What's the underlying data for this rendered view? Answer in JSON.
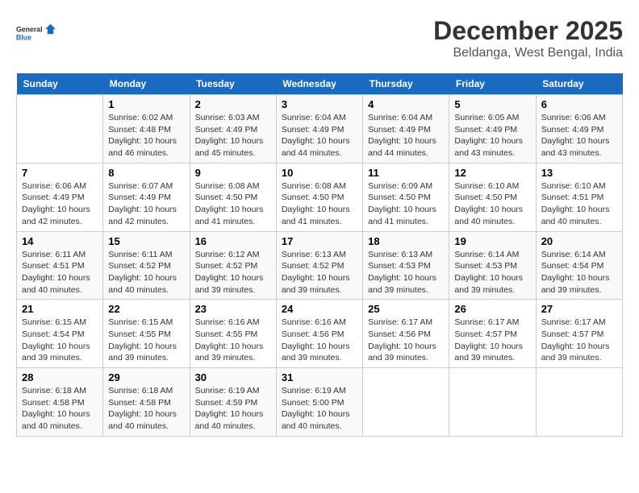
{
  "header": {
    "logo_line1": "General",
    "logo_line2": "Blue",
    "month_title": "December 2025",
    "location": "Beldanga, West Bengal, India"
  },
  "days_of_week": [
    "Sunday",
    "Monday",
    "Tuesday",
    "Wednesday",
    "Thursday",
    "Friday",
    "Saturday"
  ],
  "weeks": [
    [
      {
        "num": "",
        "sunrise": "",
        "sunset": "",
        "daylight": ""
      },
      {
        "num": "1",
        "sunrise": "Sunrise: 6:02 AM",
        "sunset": "Sunset: 4:48 PM",
        "daylight": "Daylight: 10 hours and 46 minutes."
      },
      {
        "num": "2",
        "sunrise": "Sunrise: 6:03 AM",
        "sunset": "Sunset: 4:49 PM",
        "daylight": "Daylight: 10 hours and 45 minutes."
      },
      {
        "num": "3",
        "sunrise": "Sunrise: 6:04 AM",
        "sunset": "Sunset: 4:49 PM",
        "daylight": "Daylight: 10 hours and 44 minutes."
      },
      {
        "num": "4",
        "sunrise": "Sunrise: 6:04 AM",
        "sunset": "Sunset: 4:49 PM",
        "daylight": "Daylight: 10 hours and 44 minutes."
      },
      {
        "num": "5",
        "sunrise": "Sunrise: 6:05 AM",
        "sunset": "Sunset: 4:49 PM",
        "daylight": "Daylight: 10 hours and 43 minutes."
      },
      {
        "num": "6",
        "sunrise": "Sunrise: 6:06 AM",
        "sunset": "Sunset: 4:49 PM",
        "daylight": "Daylight: 10 hours and 43 minutes."
      }
    ],
    [
      {
        "num": "7",
        "sunrise": "Sunrise: 6:06 AM",
        "sunset": "Sunset: 4:49 PM",
        "daylight": "Daylight: 10 hours and 42 minutes."
      },
      {
        "num": "8",
        "sunrise": "Sunrise: 6:07 AM",
        "sunset": "Sunset: 4:49 PM",
        "daylight": "Daylight: 10 hours and 42 minutes."
      },
      {
        "num": "9",
        "sunrise": "Sunrise: 6:08 AM",
        "sunset": "Sunset: 4:50 PM",
        "daylight": "Daylight: 10 hours and 41 minutes."
      },
      {
        "num": "10",
        "sunrise": "Sunrise: 6:08 AM",
        "sunset": "Sunset: 4:50 PM",
        "daylight": "Daylight: 10 hours and 41 minutes."
      },
      {
        "num": "11",
        "sunrise": "Sunrise: 6:09 AM",
        "sunset": "Sunset: 4:50 PM",
        "daylight": "Daylight: 10 hours and 41 minutes."
      },
      {
        "num": "12",
        "sunrise": "Sunrise: 6:10 AM",
        "sunset": "Sunset: 4:50 PM",
        "daylight": "Daylight: 10 hours and 40 minutes."
      },
      {
        "num": "13",
        "sunrise": "Sunrise: 6:10 AM",
        "sunset": "Sunset: 4:51 PM",
        "daylight": "Daylight: 10 hours and 40 minutes."
      }
    ],
    [
      {
        "num": "14",
        "sunrise": "Sunrise: 6:11 AM",
        "sunset": "Sunset: 4:51 PM",
        "daylight": "Daylight: 10 hours and 40 minutes."
      },
      {
        "num": "15",
        "sunrise": "Sunrise: 6:11 AM",
        "sunset": "Sunset: 4:52 PM",
        "daylight": "Daylight: 10 hours and 40 minutes."
      },
      {
        "num": "16",
        "sunrise": "Sunrise: 6:12 AM",
        "sunset": "Sunset: 4:52 PM",
        "daylight": "Daylight: 10 hours and 39 minutes."
      },
      {
        "num": "17",
        "sunrise": "Sunrise: 6:13 AM",
        "sunset": "Sunset: 4:52 PM",
        "daylight": "Daylight: 10 hours and 39 minutes."
      },
      {
        "num": "18",
        "sunrise": "Sunrise: 6:13 AM",
        "sunset": "Sunset: 4:53 PM",
        "daylight": "Daylight: 10 hours and 39 minutes."
      },
      {
        "num": "19",
        "sunrise": "Sunrise: 6:14 AM",
        "sunset": "Sunset: 4:53 PM",
        "daylight": "Daylight: 10 hours and 39 minutes."
      },
      {
        "num": "20",
        "sunrise": "Sunrise: 6:14 AM",
        "sunset": "Sunset: 4:54 PM",
        "daylight": "Daylight: 10 hours and 39 minutes."
      }
    ],
    [
      {
        "num": "21",
        "sunrise": "Sunrise: 6:15 AM",
        "sunset": "Sunset: 4:54 PM",
        "daylight": "Daylight: 10 hours and 39 minutes."
      },
      {
        "num": "22",
        "sunrise": "Sunrise: 6:15 AM",
        "sunset": "Sunset: 4:55 PM",
        "daylight": "Daylight: 10 hours and 39 minutes."
      },
      {
        "num": "23",
        "sunrise": "Sunrise: 6:16 AM",
        "sunset": "Sunset: 4:55 PM",
        "daylight": "Daylight: 10 hours and 39 minutes."
      },
      {
        "num": "24",
        "sunrise": "Sunrise: 6:16 AM",
        "sunset": "Sunset: 4:56 PM",
        "daylight": "Daylight: 10 hours and 39 minutes."
      },
      {
        "num": "25",
        "sunrise": "Sunrise: 6:17 AM",
        "sunset": "Sunset: 4:56 PM",
        "daylight": "Daylight: 10 hours and 39 minutes."
      },
      {
        "num": "26",
        "sunrise": "Sunrise: 6:17 AM",
        "sunset": "Sunset: 4:57 PM",
        "daylight": "Daylight: 10 hours and 39 minutes."
      },
      {
        "num": "27",
        "sunrise": "Sunrise: 6:17 AM",
        "sunset": "Sunset: 4:57 PM",
        "daylight": "Daylight: 10 hours and 39 minutes."
      }
    ],
    [
      {
        "num": "28",
        "sunrise": "Sunrise: 6:18 AM",
        "sunset": "Sunset: 4:58 PM",
        "daylight": "Daylight: 10 hours and 40 minutes."
      },
      {
        "num": "29",
        "sunrise": "Sunrise: 6:18 AM",
        "sunset": "Sunset: 4:58 PM",
        "daylight": "Daylight: 10 hours and 40 minutes."
      },
      {
        "num": "30",
        "sunrise": "Sunrise: 6:19 AM",
        "sunset": "Sunset: 4:59 PM",
        "daylight": "Daylight: 10 hours and 40 minutes."
      },
      {
        "num": "31",
        "sunrise": "Sunrise: 6:19 AM",
        "sunset": "Sunset: 5:00 PM",
        "daylight": "Daylight: 10 hours and 40 minutes."
      },
      {
        "num": "",
        "sunrise": "",
        "sunset": "",
        "daylight": ""
      },
      {
        "num": "",
        "sunrise": "",
        "sunset": "",
        "daylight": ""
      },
      {
        "num": "",
        "sunrise": "",
        "sunset": "",
        "daylight": ""
      }
    ]
  ]
}
